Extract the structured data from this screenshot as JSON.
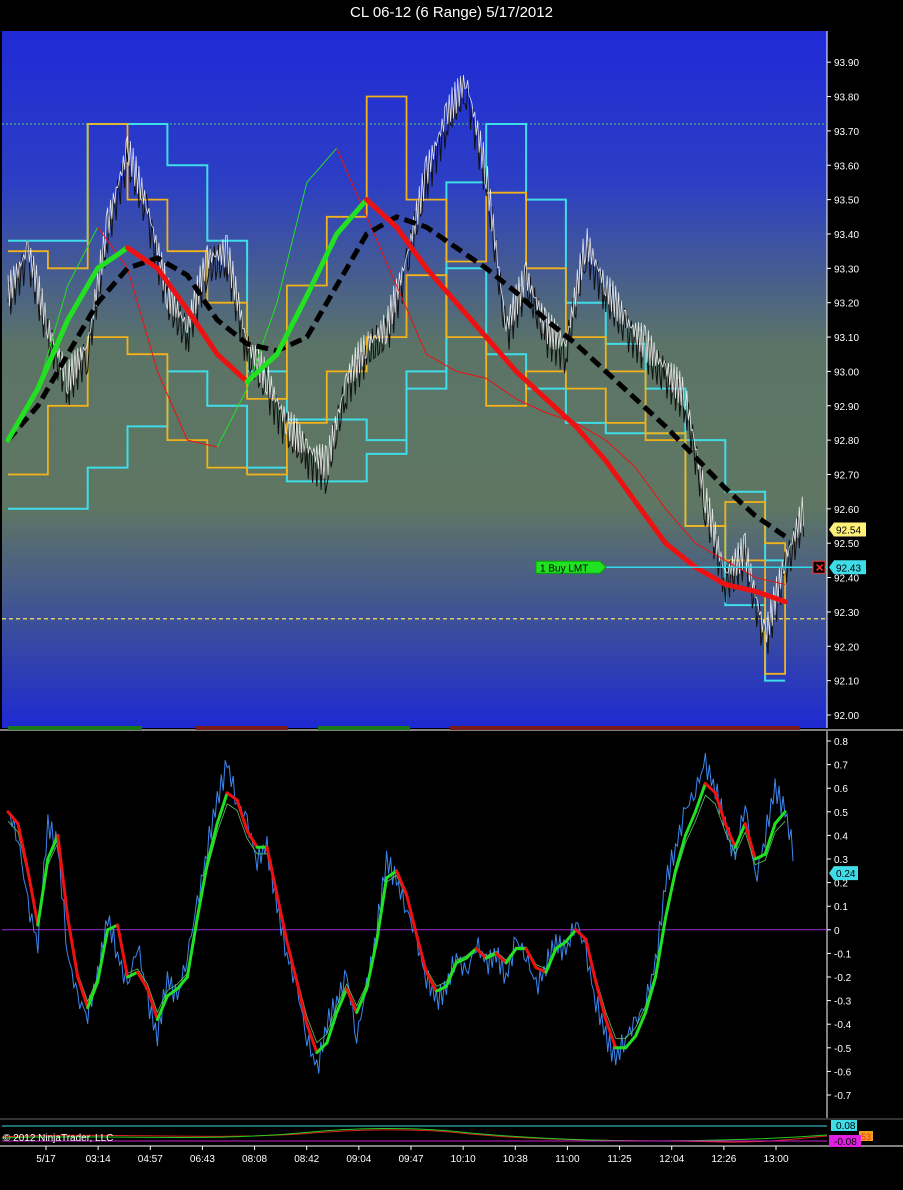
{
  "window": {
    "title": "CL 06-12 (6 Range)  5/17/2012"
  },
  "colors": {
    "band_outer": "#3fdde8",
    "band_inner": "#f2b21a",
    "trend_up": "#22e022",
    "trend_down": "#ee1111",
    "trend_slow": "#000000",
    "price": "#ffffff",
    "osc_raw": "#3a86f0",
    "zero_line": "#9a2fd0",
    "order_line": "#30d8e8"
  },
  "chart_data": [
    {
      "type": "line",
      "ylim": [
        92.0,
        93.95
      ],
      "y_ticks": [
        "93.90",
        "93.80",
        "93.70",
        "93.60",
        "93.50",
        "93.40",
        "93.30",
        "93.20",
        "93.10",
        "93.00",
        "92.90",
        "92.80",
        "92.70",
        "92.60",
        "92.50",
        "92.40",
        "92.30",
        "92.20",
        "92.10",
        "92.00"
      ],
      "h_lines": [
        93.72,
        92.28
      ],
      "last_price_label": "92.54",
      "last_price": 92.54,
      "order": {
        "label": "1  Buy LMT",
        "price_label": "92.43",
        "price": 92.43
      },
      "x_max": 160,
      "series": [
        {
          "x": [
            0,
            4,
            8,
            12,
            16,
            20,
            24,
            28,
            32,
            36,
            40,
            44,
            48,
            52,
            56,
            60,
            64,
            68,
            72,
            76,
            80,
            84,
            88,
            92,
            96,
            100,
            104,
            108,
            112,
            116,
            120,
            124,
            128,
            132,
            136,
            140,
            144,
            148,
            152,
            156,
            160
          ],
          "y": [
            93.2,
            93.33,
            93.1,
            92.95,
            93.05,
            93.4,
            93.62,
            93.45,
            93.2,
            93.1,
            93.3,
            93.32,
            93.05,
            92.95,
            92.82,
            92.75,
            92.7,
            92.95,
            93.05,
            93.1,
            93.3,
            93.55,
            93.72,
            93.82,
            93.55,
            93.1,
            93.25,
            93.1,
            93.05,
            93.35,
            93.22,
            93.12,
            93.05,
            92.98,
            92.9,
            92.6,
            92.38,
            92.45,
            92.2,
            92.42,
            92.58
          ]
        },
        {
          "x": [
            0,
            6,
            12,
            18,
            24,
            30,
            36,
            42,
            48,
            54,
            60,
            66,
            72,
            78,
            84,
            90,
            96,
            102,
            108,
            114,
            120,
            126,
            132,
            138,
            144,
            150,
            156
          ],
          "y": [
            92.8,
            92.95,
            93.15,
            93.3,
            93.36,
            93.3,
            93.18,
            93.05,
            92.97,
            93.05,
            93.22,
            93.4,
            93.5,
            93.42,
            93.3,
            93.2,
            93.1,
            93.0,
            92.92,
            92.84,
            92.74,
            92.62,
            92.5,
            92.43,
            92.38,
            92.36,
            92.33
          ]
        },
        {
          "x": [
            0,
            6,
            12,
            18,
            24,
            30,
            36,
            42,
            48,
            54,
            60,
            66,
            72,
            78,
            84,
            90,
            96,
            102,
            108,
            114,
            120,
            126,
            132,
            138,
            144,
            150,
            156
          ],
          "y": [
            92.8,
            92.9,
            93.05,
            93.2,
            93.3,
            93.33,
            93.28,
            93.15,
            93.08,
            93.06,
            93.1,
            93.25,
            93.4,
            93.45,
            93.42,
            93.36,
            93.3,
            93.23,
            93.15,
            93.08,
            93.0,
            92.92,
            92.84,
            92.75,
            92.66,
            92.58,
            92.52
          ]
        },
        {
          "x": [
            0,
            6,
            12,
            18,
            24,
            30,
            36,
            42,
            48,
            54,
            60,
            66,
            72,
            78,
            84,
            90,
            96,
            102,
            108,
            114,
            120,
            126,
            132,
            138,
            144,
            150,
            156
          ],
          "y": [
            92.8,
            92.95,
            93.25,
            93.42,
            93.3,
            93.0,
            92.8,
            92.78,
            92.95,
            93.2,
            93.55,
            93.65,
            93.45,
            93.25,
            93.05,
            93.0,
            92.98,
            92.92,
            92.88,
            92.85,
            92.8,
            92.72,
            92.6,
            92.5,
            92.45,
            92.4,
            92.38
          ]
        },
        {
          "x": [
            0,
            8,
            16,
            24,
            32,
            40,
            48,
            56,
            64,
            72,
            80,
            88,
            96,
            104,
            112,
            120,
            128,
            136,
            144,
            152,
            156
          ],
          "y": [
            93.38,
            93.38,
            93.72,
            93.72,
            93.6,
            93.38,
            93.0,
            92.86,
            92.86,
            92.8,
            92.95,
            93.55,
            93.72,
            93.5,
            93.2,
            93.08,
            92.95,
            92.8,
            92.65,
            92.45,
            92.42
          ]
        },
        {
          "x": [
            0,
            8,
            16,
            24,
            32,
            40,
            48,
            56,
            64,
            72,
            80,
            88,
            96,
            104,
            112,
            120,
            128,
            136,
            144,
            152,
            156
          ],
          "y": [
            92.6,
            92.6,
            92.72,
            92.84,
            93.0,
            92.9,
            92.72,
            92.68,
            92.68,
            92.76,
            93.0,
            93.3,
            93.05,
            92.95,
            92.85,
            92.82,
            92.82,
            92.55,
            92.32,
            92.1,
            92.1
          ]
        },
        {
          "x": [
            0,
            8,
            16,
            24,
            32,
            40,
            48,
            56,
            64,
            72,
            80,
            88,
            96,
            104,
            112,
            120,
            128,
            136,
            144,
            152,
            156
          ],
          "y": [
            93.35,
            93.3,
            93.72,
            93.5,
            93.35,
            93.2,
            92.92,
            93.25,
            93.45,
            93.8,
            93.5,
            93.32,
            93.52,
            93.3,
            93.1,
            93.0,
            92.8,
            92.55,
            92.62,
            92.5,
            92.45
          ]
        },
        {
          "x": [
            0,
            8,
            16,
            24,
            32,
            40,
            48,
            56,
            64,
            72,
            80,
            88,
            96,
            104,
            112,
            120,
            128,
            136,
            144,
            152,
            156
          ],
          "y": [
            92.7,
            92.9,
            93.1,
            93.05,
            92.8,
            92.72,
            92.7,
            92.85,
            93.0,
            93.1,
            93.28,
            93.1,
            92.9,
            93.0,
            92.95,
            92.85,
            92.82,
            92.55,
            92.45,
            92.12,
            92.42
          ]
        }
      ]
    },
    {
      "type": "line",
      "ylim": [
        -0.8,
        0.85
      ],
      "y_ticks": [
        "0.8",
        "0.7",
        "0.6",
        "0.5",
        "0.4",
        "0.3",
        "0.2",
        "0.1",
        "0",
        "-0.1",
        "-0.2",
        "-0.3",
        "-0.4",
        "-0.5",
        "-0.6",
        "-0.7"
      ],
      "last_value_label": "0.24",
      "last_value": 0.24,
      "zero_line": 0,
      "x_max": 160,
      "series": [
        {
          "x": [
            0,
            2,
            4,
            6,
            8,
            10,
            12,
            14,
            16,
            18,
            20,
            22,
            24,
            26,
            28,
            30,
            32,
            34,
            36,
            38,
            40,
            42,
            44,
            46,
            48,
            50,
            52,
            54,
            56,
            58,
            60,
            62,
            64,
            66,
            68,
            70,
            72,
            74,
            76,
            78,
            80,
            82,
            84,
            86,
            88,
            90,
            92,
            94,
            96,
            98,
            100,
            102,
            104,
            106,
            108,
            110,
            112,
            114,
            116,
            118,
            120,
            122,
            124,
            126,
            128,
            130,
            132,
            134,
            136,
            138,
            140,
            142,
            144,
            146,
            148,
            150,
            152,
            154,
            156,
            158
          ],
          "y": [
            0.5,
            0.4,
            0.1,
            -0.05,
            0.45,
            0.35,
            -0.1,
            -0.3,
            -0.35,
            -0.2,
            0.05,
            -0.1,
            -0.25,
            -0.05,
            -0.3,
            -0.45,
            -0.2,
            -0.3,
            -0.1,
            0.1,
            0.35,
            0.55,
            0.7,
            0.55,
            0.45,
            0.3,
            0.35,
            0.1,
            -0.1,
            -0.25,
            -0.45,
            -0.6,
            -0.4,
            -0.3,
            -0.2,
            -0.45,
            -0.25,
            0.0,
            0.3,
            0.2,
            0.1,
            -0.05,
            -0.2,
            -0.3,
            -0.25,
            -0.1,
            -0.2,
            -0.05,
            -0.15,
            -0.1,
            -0.2,
            -0.05,
            -0.1,
            -0.25,
            -0.15,
            -0.05,
            -0.1,
            0.05,
            -0.1,
            -0.3,
            -0.45,
            -0.55,
            -0.45,
            -0.4,
            -0.3,
            -0.15,
            0.2,
            0.35,
            0.5,
            0.6,
            0.7,
            0.6,
            0.45,
            0.3,
            0.55,
            0.2,
            0.4,
            0.6,
            0.5,
            0.3
          ]
        },
        {
          "x": [
            0,
            2,
            4,
            6,
            8,
            10,
            12,
            14,
            16,
            18,
            20,
            22,
            24,
            26,
            28,
            30,
            32,
            34,
            36,
            38,
            40,
            42,
            44,
            46,
            48,
            50,
            52,
            54,
            56,
            58,
            60,
            62,
            64,
            66,
            68,
            70,
            72,
            74,
            76,
            78,
            80,
            82,
            84,
            86,
            88,
            90,
            92,
            94,
            96,
            98,
            100,
            102,
            104,
            106,
            108,
            110,
            112,
            114,
            116,
            118,
            120,
            122,
            124,
            126,
            128,
            130,
            132,
            134,
            136,
            138,
            140,
            142,
            144,
            146,
            148,
            150,
            152,
            154,
            156
          ],
          "y": [
            0.5,
            0.45,
            0.25,
            0.02,
            0.3,
            0.4,
            0.05,
            -0.2,
            -0.33,
            -0.22,
            0.0,
            0.02,
            -0.2,
            -0.18,
            -0.25,
            -0.38,
            -0.28,
            -0.25,
            -0.2,
            0.05,
            0.28,
            0.45,
            0.58,
            0.55,
            0.42,
            0.35,
            0.35,
            0.15,
            -0.05,
            -0.22,
            -0.4,
            -0.52,
            -0.48,
            -0.35,
            -0.25,
            -0.35,
            -0.25,
            -0.05,
            0.22,
            0.25,
            0.15,
            -0.02,
            -0.18,
            -0.26,
            -0.24,
            -0.14,
            -0.12,
            -0.08,
            -0.12,
            -0.1,
            -0.14,
            -0.08,
            -0.08,
            -0.16,
            -0.18,
            -0.08,
            -0.05,
            0.0,
            -0.04,
            -0.22,
            -0.38,
            -0.5,
            -0.5,
            -0.45,
            -0.35,
            -0.2,
            0.05,
            0.25,
            0.4,
            0.5,
            0.62,
            0.58,
            0.45,
            0.35,
            0.45,
            0.3,
            0.32,
            0.45,
            0.5
          ]
        }
      ]
    }
  ],
  "x_axis": {
    "labels": [
      "5/17",
      "03:14",
      "04:57",
      "06:43",
      "08:08",
      "08:42",
      "09:04",
      "09:47",
      "10:10",
      "10:38",
      "11:00",
      "11:25",
      "12:04",
      "12:26",
      "13:00"
    ]
  },
  "bottom_panel": {
    "value_label_1": "0.08",
    "value_label_2": "-0.08",
    "value_label_3": "53"
  },
  "copyright": "© 2012 NinjaTrader, LLC"
}
